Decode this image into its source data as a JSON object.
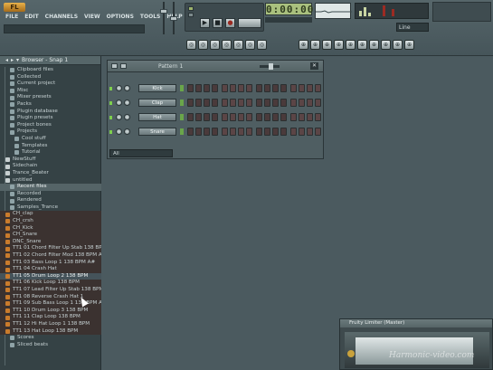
{
  "app": {
    "logo": "FL",
    "menu": [
      "FILE",
      "EDIT",
      "CHANNELS",
      "VIEW",
      "OPTIONS",
      "TOOLS",
      "HELP"
    ],
    "time": "0:00:00",
    "pattern_select": "Line"
  },
  "transport": {
    "play_label": "▶",
    "stop_label": "■",
    "record_label": "●"
  },
  "toolbar_buttons_row1": [
    "◎",
    "◎",
    "◎",
    "◎",
    "◎",
    "◎",
    "◎"
  ],
  "toolbar_buttons_row2": [
    "⊕",
    "⊕",
    "⊕",
    "⊕",
    "⊕",
    "⊕",
    "⊕",
    "⊕",
    "⊕",
    "⊕"
  ],
  "browser": {
    "title": "Browser - Snap 1",
    "items": [
      {
        "label": "Clipboard files",
        "type": "folder",
        "indent": 1
      },
      {
        "label": "Collected",
        "type": "folder",
        "indent": 1
      },
      {
        "label": "Current project",
        "type": "folder",
        "indent": 1
      },
      {
        "label": "Misc",
        "type": "folder",
        "indent": 1
      },
      {
        "label": "Mixer presets",
        "type": "folder",
        "indent": 1
      },
      {
        "label": "Packs",
        "type": "folder",
        "indent": 1
      },
      {
        "label": "Plugin database",
        "type": "folder",
        "indent": 1
      },
      {
        "label": "Plugin presets",
        "type": "folder",
        "indent": 1
      },
      {
        "label": "Project bones",
        "type": "folder",
        "indent": 1
      },
      {
        "label": "Projects",
        "type": "folder",
        "indent": 1
      },
      {
        "label": "Cool stuff",
        "type": "folder",
        "indent": 2
      },
      {
        "label": "Templates",
        "type": "folder",
        "indent": 2
      },
      {
        "label": "Tutorial",
        "type": "folder",
        "indent": 2
      },
      {
        "label": "NewStuff",
        "type": "nfolder",
        "indent": 0
      },
      {
        "label": "Sidechain",
        "type": "nfolder",
        "indent": 0
      },
      {
        "label": "Trance_Beater",
        "type": "nfolder",
        "indent": 0
      },
      {
        "label": "untitled",
        "type": "nfolder",
        "indent": 0
      },
      {
        "label": "Recent files",
        "type": "folder",
        "indent": 1,
        "selected": true
      },
      {
        "label": "Recorded",
        "type": "folder",
        "indent": 1
      },
      {
        "label": "Rendered",
        "type": "folder",
        "indent": 1
      },
      {
        "label": "Samples_Trance",
        "type": "folder",
        "indent": 1
      },
      {
        "label": "CH_clap",
        "type": "file",
        "indent": 0
      },
      {
        "label": "CH_crsh",
        "type": "file",
        "indent": 0
      },
      {
        "label": "CH_Kick",
        "type": "file",
        "indent": 0
      },
      {
        "label": "CH_Snare",
        "type": "file",
        "indent": 0
      },
      {
        "label": "DNC_Snare",
        "type": "file",
        "indent": 0
      },
      {
        "label": "TT1 01 Chord Filter Up Stab 138 BPM",
        "type": "file",
        "indent": 0
      },
      {
        "label": "TT1 02 Chord Filter Mod 138 BPM A",
        "type": "file",
        "indent": 0
      },
      {
        "label": "TT1 03 Bass Loop 1 138 BPM A#",
        "type": "file",
        "indent": 0
      },
      {
        "label": "TT1 04 Crash Hat",
        "type": "file",
        "indent": 0
      },
      {
        "label": "TT1 05 Drum Loop 2 138 BPM",
        "type": "file",
        "indent": 0,
        "highlighted": true
      },
      {
        "label": "TT1 06 Kick Loop 138 BPM",
        "type": "file",
        "indent": 0
      },
      {
        "label": "TT1 07 Lead Filter Up Stab 138 BPM",
        "type": "file",
        "indent": 0
      },
      {
        "label": "TT1 08 Reverse Crash Hat 1",
        "type": "file",
        "indent": 0
      },
      {
        "label": "TT1 09 Sub Bass Loop 1 138 BPM A#",
        "type": "file",
        "indent": 0
      },
      {
        "label": "TT1 10 Drum Loop 3 138 BPM",
        "type": "file",
        "indent": 0
      },
      {
        "label": "TT1 11 Clap Loop 138 BPM",
        "type": "file",
        "indent": 0
      },
      {
        "label": "TT1 12 Hi Hat Loop 1 138 BPM",
        "type": "file",
        "indent": 0
      },
      {
        "label": "TT1 13 Hat Loop 138 BPM",
        "type": "file",
        "indent": 0
      },
      {
        "label": "Scores",
        "type": "folder",
        "indent": 1
      },
      {
        "label": "Sliced beats",
        "type": "folder",
        "indent": 1
      }
    ]
  },
  "channel_rack": {
    "title": "Pattern 1",
    "channels": [
      "Kick",
      "Clap",
      "Hat",
      "Snare"
    ],
    "filter": "All"
  },
  "plugin": {
    "title": "Fruity Limiter (Master)"
  },
  "watermark": "Harmonic-video.com"
}
